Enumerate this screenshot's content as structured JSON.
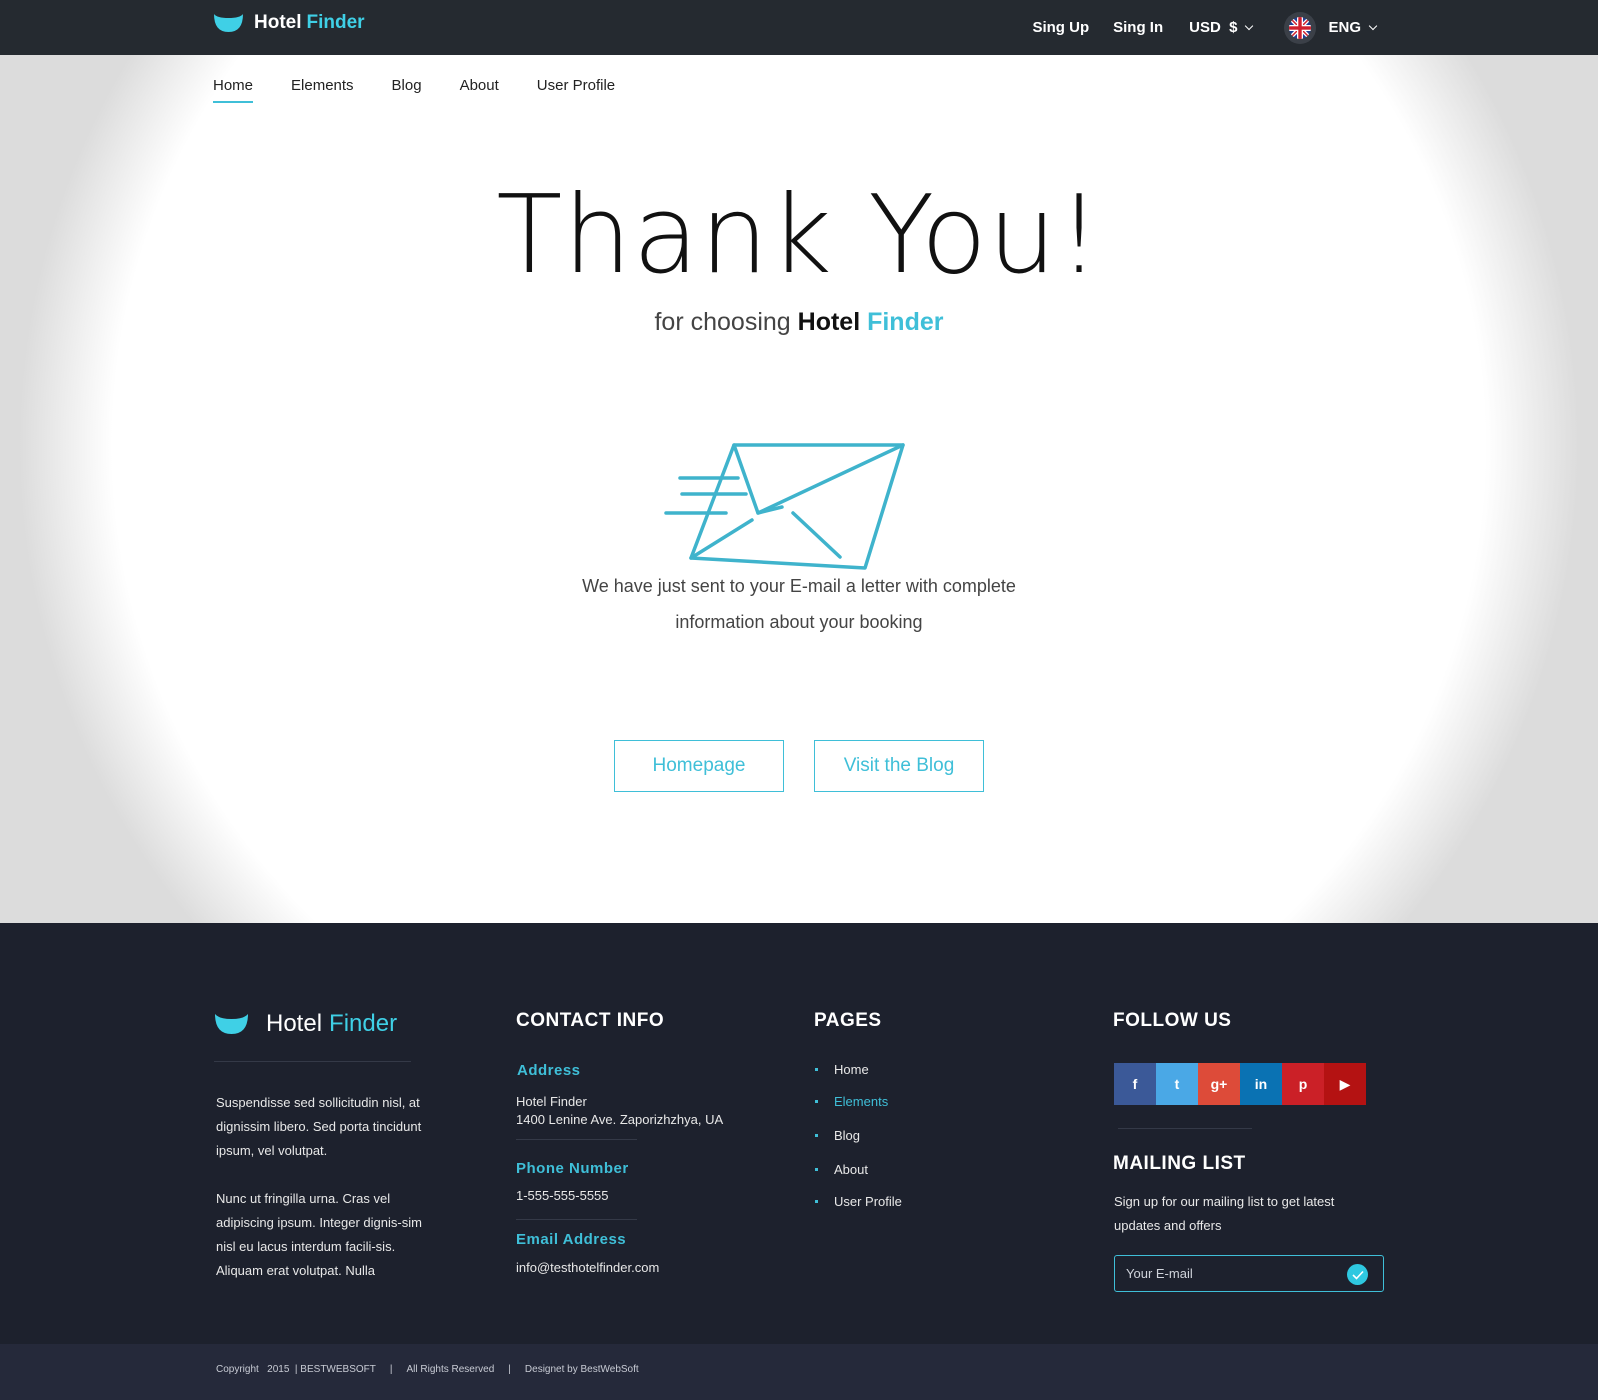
{
  "header": {
    "brand": {
      "word1": "Hotel",
      "word2": "Finder"
    },
    "sign_up": "Sing Up",
    "sign_in": "Sing In",
    "currency": "USD  $",
    "language": "ENG"
  },
  "nav": {
    "items": [
      {
        "label": "Home",
        "active": true
      },
      {
        "label": "Elements",
        "active": false
      },
      {
        "label": "Blog",
        "active": false
      },
      {
        "label": "About",
        "active": false
      },
      {
        "label": "User Profile",
        "active": false
      }
    ]
  },
  "hero": {
    "title": "Thank You!",
    "sub_prefix": "for choosing",
    "sub_word1": "Hotel",
    "sub_word2": "Finder",
    "message_line1": "We have just sent to your E-mail a letter with complete",
    "message_line2": "information about your booking",
    "btn_homepage": "Homepage",
    "btn_blog": "Visit the Blog"
  },
  "footer": {
    "brand": {
      "word1": "Hotel",
      "word2": "Finder"
    },
    "about_p1": "Suspendisse sed sollicitudin nisl, at dignissim libero. Sed porta tincidunt ipsum, vel volutpat.",
    "about_p2": "Nunc ut fringilla urna. Cras vel adipiscing ipsum. Integer dignis-sim nisl eu lacus interdum facili-sis. Aliquam erat volutpat. Nulla",
    "contact": {
      "heading": "CONTACT INFO",
      "address_label": "Address",
      "address_line1": "Hotel Finder",
      "address_line2": "1400 Lenine Ave. Zaporizhzhya, UA",
      "phone_label": "Phone Number",
      "phone": "1-555-555-5555",
      "email_label": "Email Address",
      "email": "info@testhotelfinder.com"
    },
    "pages": {
      "heading": "PAGES",
      "items": [
        {
          "label": "Home",
          "active": false
        },
        {
          "label": "Elements",
          "active": true
        },
        {
          "label": "Blog",
          "active": false
        },
        {
          "label": "About",
          "active": false
        },
        {
          "label": "User Profile",
          "active": false
        }
      ]
    },
    "follow": {
      "heading": "FOLLOW US",
      "networks": [
        {
          "name": "facebook-icon",
          "glyph": "f",
          "color": "#3b5998"
        },
        {
          "name": "twitter-icon",
          "glyph": "t",
          "color": "#4aa8e6"
        },
        {
          "name": "google-plus-icon",
          "glyph": "g+",
          "color": "#dd4b39"
        },
        {
          "name": "linkedin-icon",
          "glyph": "in",
          "color": "#0a72b3"
        },
        {
          "name": "pinterest-icon",
          "glyph": "p",
          "color": "#cb2027"
        },
        {
          "name": "youtube-icon",
          "glyph": "▶",
          "color": "#b41212"
        }
      ]
    },
    "mailing": {
      "heading": "MAILING LIST",
      "description": "Sign up for our mailing list to get latest updates and offers",
      "placeholder": "Your E-mail"
    },
    "copyright": {
      "part1": "Copyright   2015  | BESTWEBSOFT",
      "sep1": "|",
      "part2": "All Rights Reserved",
      "sep2": "|",
      "part3": "Designet by BestWebSoft"
    }
  },
  "colors": {
    "accent": "#3fbfd8",
    "topbar": "#252a30",
    "footer": "#1d212d",
    "bottombar": "#25293a"
  }
}
